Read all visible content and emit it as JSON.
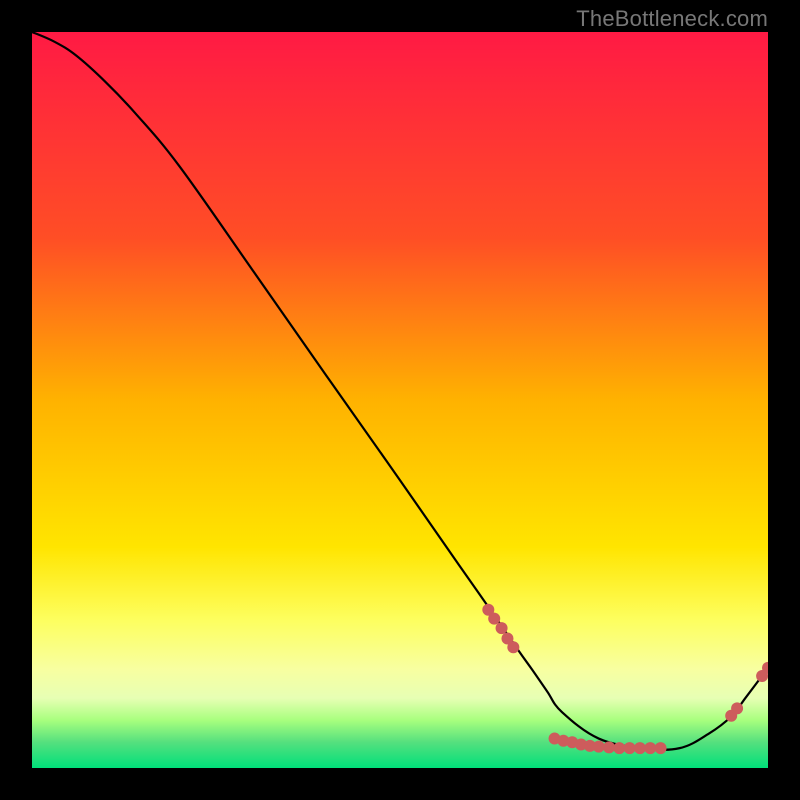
{
  "watermark": "TheBottleneck.com",
  "chart_data": {
    "type": "line",
    "title": "",
    "xlabel": "",
    "ylabel": "",
    "xlim": [
      0,
      100
    ],
    "ylim": [
      0,
      100
    ],
    "grid": false,
    "series": [
      {
        "name": "curve",
        "x": [
          0,
          3,
          6,
          10,
          14,
          20,
          30,
          40,
          50,
          58,
          62,
          66,
          68,
          70,
          72,
          77,
          83,
          88,
          92,
          95,
          97,
          100
        ],
        "y": [
          100,
          98.7,
          96.8,
          93.2,
          89,
          81.8,
          67.6,
          53.3,
          39.1,
          27.6,
          21.9,
          16.1,
          13.3,
          10.4,
          7.6,
          4.0,
          2.7,
          2.7,
          4.7,
          7.0,
          9.6,
          13.6
        ]
      }
    ],
    "markers": [
      {
        "x": 62.0,
        "y": 21.5
      },
      {
        "x": 62.8,
        "y": 20.3
      },
      {
        "x": 63.8,
        "y": 19.0
      },
      {
        "x": 64.6,
        "y": 17.6
      },
      {
        "x": 65.4,
        "y": 16.4
      },
      {
        "x": 71.0,
        "y": 4.0
      },
      {
        "x": 72.2,
        "y": 3.7
      },
      {
        "x": 73.4,
        "y": 3.5
      },
      {
        "x": 74.6,
        "y": 3.2
      },
      {
        "x": 75.8,
        "y": 3.0
      },
      {
        "x": 77.0,
        "y": 2.9
      },
      {
        "x": 78.4,
        "y": 2.8
      },
      {
        "x": 79.8,
        "y": 2.7
      },
      {
        "x": 81.2,
        "y": 2.7
      },
      {
        "x": 82.6,
        "y": 2.7
      },
      {
        "x": 84.0,
        "y": 2.7
      },
      {
        "x": 85.4,
        "y": 2.7
      },
      {
        "x": 95.0,
        "y": 7.1
      },
      {
        "x": 95.8,
        "y": 8.1
      },
      {
        "x": 99.2,
        "y": 12.5
      },
      {
        "x": 100.0,
        "y": 13.6
      }
    ],
    "colors": {
      "curve": "#000000",
      "marker_fill": "#cd5c5c",
      "marker_stroke": "#8b2f2f",
      "grad_top": "#ff1a44",
      "grad_mid1": "#ff7a00",
      "grad_mid2": "#ffe500",
      "grad_band": "#f8ffa0",
      "grad_green1": "#a8ff7e",
      "grad_green2": "#00e07a"
    }
  }
}
